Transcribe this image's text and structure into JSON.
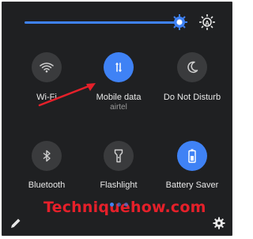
{
  "brightness": {
    "level_percent": 85,
    "auto_icon": "brightness-auto-icon"
  },
  "tiles": [
    {
      "label": "Wi-Fi",
      "icon": "wifi-icon",
      "active": false
    },
    {
      "label": "Mobile data",
      "sublabel": "airtel",
      "icon": "mobile-data-icon",
      "active": true
    },
    {
      "label": "Do Not Disturb",
      "icon": "moon-icon",
      "active": false
    },
    {
      "label": "Bluetooth",
      "icon": "bluetooth-icon",
      "active": false
    },
    {
      "label": "Flashlight",
      "icon": "flashlight-icon",
      "active": false
    },
    {
      "label": "Battery Saver",
      "icon": "battery-saver-icon",
      "active": true
    }
  ],
  "watermark": "Techniquehow.com",
  "pager": {
    "pages": 3,
    "current": 1
  },
  "footer": {
    "left_icon": "edit-icon",
    "right_icon": "gear-icon"
  },
  "colors": {
    "accent": "#3f82f5",
    "background": "#1f2022",
    "tile_inactive": "#3a3b3d",
    "watermark": "#e5202a"
  }
}
